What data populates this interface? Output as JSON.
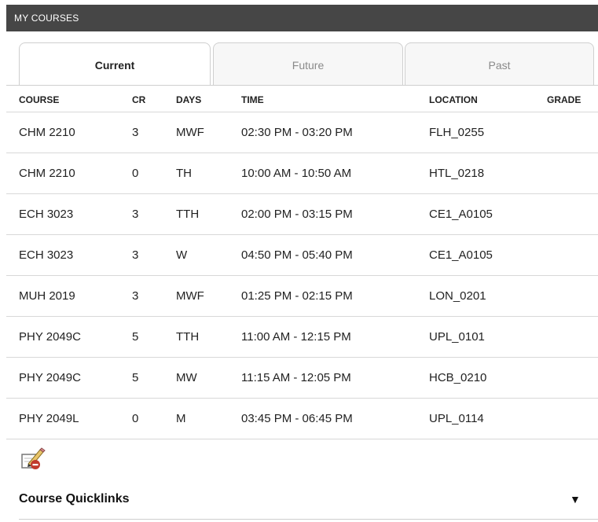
{
  "header": {
    "title": "MY COURSES"
  },
  "tabs": [
    {
      "label": "Current",
      "active": true
    },
    {
      "label": "Future",
      "active": false
    },
    {
      "label": "Past",
      "active": false
    }
  ],
  "columns": [
    "COURSE",
    "CR",
    "DAYS",
    "TIME",
    "LOCATION",
    "GRADE"
  ],
  "rows": [
    {
      "course": "CHM 2210",
      "cr": "3",
      "days": "MWF",
      "time": "02:30 PM - 03:20 PM",
      "location": "FLH_0255",
      "grade": ""
    },
    {
      "course": "CHM 2210",
      "cr": "0",
      "days": "TH",
      "time": "10:00 AM - 10:50 AM",
      "location": "HTL_0218",
      "grade": ""
    },
    {
      "course": "ECH 3023",
      "cr": "3",
      "days": "TTH",
      "time": "02:00 PM - 03:15 PM",
      "location": "CE1_A0105",
      "grade": ""
    },
    {
      "course": "ECH 3023",
      "cr": "3",
      "days": "W",
      "time": "04:50 PM - 05:40 PM",
      "location": "CE1_A0105",
      "grade": ""
    },
    {
      "course": "MUH 2019",
      "cr": "3",
      "days": "MWF",
      "time": "01:25 PM - 02:15 PM",
      "location": "LON_0201",
      "grade": ""
    },
    {
      "course": "PHY 2049C",
      "cr": "5",
      "days": "TTH",
      "time": "11:00 AM - 12:15 PM",
      "location": "UPL_0101",
      "grade": ""
    },
    {
      "course": "PHY 2049C",
      "cr": "5",
      "days": "MW",
      "time": "11:15 AM - 12:05 PM",
      "location": "HCB_0210",
      "grade": ""
    },
    {
      "course": "PHY 2049L",
      "cr": "0",
      "days": "M",
      "time": "03:45 PM - 06:45 PM",
      "location": "UPL_0114",
      "grade": ""
    }
  ],
  "quicklinks": {
    "label": "Course Quicklinks",
    "arrow": "▼"
  },
  "colors": {
    "header_bg": "#464646",
    "border": "#d8d8d8"
  },
  "icons": {
    "edit": "edit-drop-icon"
  }
}
